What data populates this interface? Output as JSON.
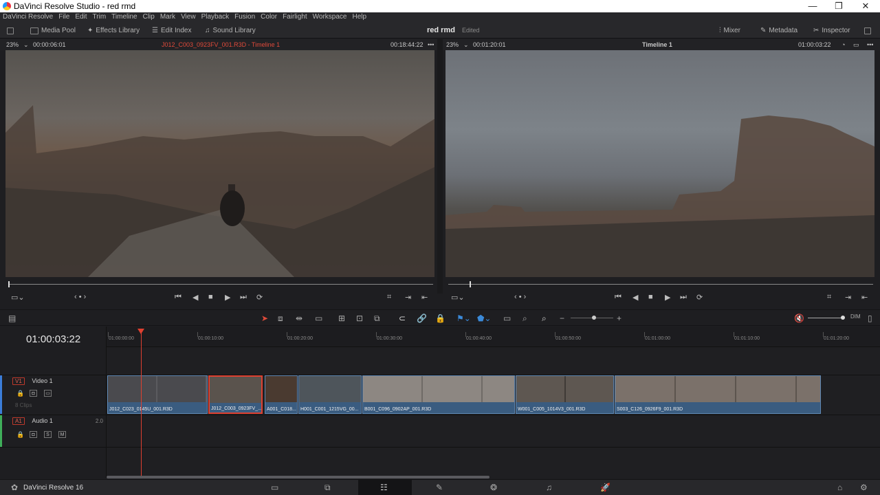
{
  "window": {
    "title": "DaVinci Resolve Studio - red rmd"
  },
  "menu": [
    "DaVinci Resolve",
    "File",
    "Edit",
    "Trim",
    "Timeline",
    "Clip",
    "Mark",
    "View",
    "Playback",
    "Fusion",
    "Color",
    "Fairlight",
    "Workspace",
    "Help"
  ],
  "toolbar": {
    "media_pool": "Media Pool",
    "effects_library": "Effects Library",
    "edit_index": "Edit Index",
    "sound_library": "Sound Library",
    "project": "red rmd",
    "status": "Edited",
    "mixer": "Mixer",
    "metadata": "Metadata",
    "inspector": "Inspector"
  },
  "source_viewer": {
    "zoom": "23%",
    "timecode": "00:00:06:01",
    "clip": "J012_C003_0923FV_001.R3D - Timeline 1",
    "duration": "00:18:44:22"
  },
  "timeline_viewer": {
    "zoom": "23%",
    "timecode": "00:01:20:01",
    "timeline": "Timeline 1",
    "position": "01:00:03:22"
  },
  "timeline": {
    "current_tc": "01:00:03:22",
    "ruler": [
      "01:00:00:00",
      "01:00:10:00",
      "01:00:20:00",
      "01:00:30:00",
      "01:00:40:00",
      "01:00:50:00",
      "01:01:00:00",
      "01:01:10:00",
      "01:01:20:00"
    ],
    "video_track": {
      "badge": "V1",
      "name": "Video 1",
      "clips_count": "8 Clips"
    },
    "audio_track": {
      "badge": "A1",
      "name": "Audio 1",
      "channels": "2.0",
      "solo": "S",
      "mute": "M"
    },
    "clips": [
      {
        "label": "J012_C023_0145U_001.R3D"
      },
      {
        "label": "J012_C003_0923FV_..."
      },
      {
        "label": "A001_C018..."
      },
      {
        "label": "H001_C001_1215VG_00..."
      },
      {
        "label": "B001_C096_0902AP_001.R3D"
      },
      {
        "label": "W001_C005_1014V3_001.R3D"
      },
      {
        "label": "S003_C126_0926F9_001.R3D"
      }
    ]
  },
  "footer": {
    "app": "DaVinci Resolve 16"
  }
}
